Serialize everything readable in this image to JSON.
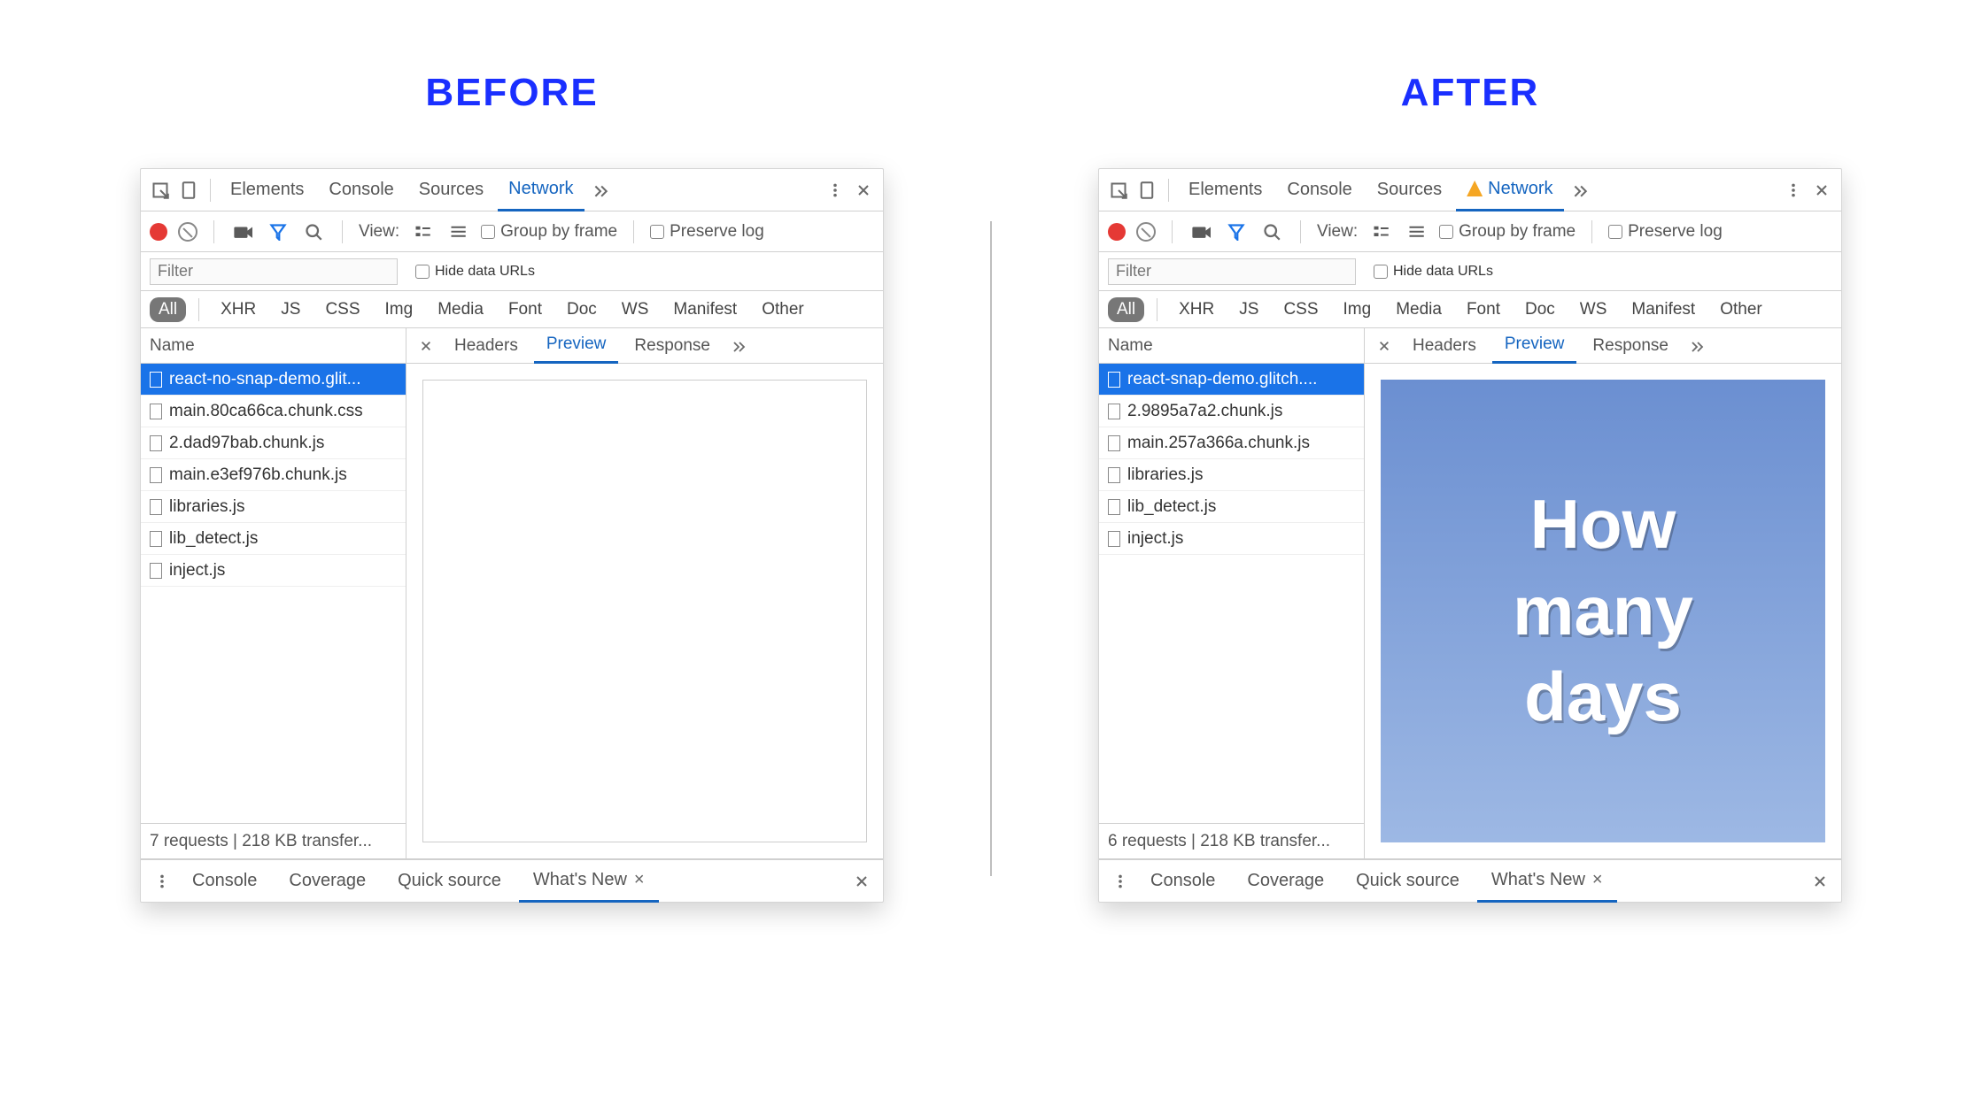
{
  "headings": {
    "before": "BEFORE",
    "after": "AFTER"
  },
  "devtools": {
    "tabs": [
      "Elements",
      "Console",
      "Sources",
      "Network"
    ],
    "toolbar": {
      "view_label": "View:",
      "group_by_frame": "Group by frame",
      "preserve_log": "Preserve log"
    },
    "filter": {
      "placeholder": "Filter",
      "hide_data_urls": "Hide data URLs"
    },
    "types": [
      "All",
      "XHR",
      "JS",
      "CSS",
      "Img",
      "Media",
      "Font",
      "Doc",
      "WS",
      "Manifest",
      "Other"
    ],
    "columns": {
      "name": "Name"
    },
    "response_tabs": [
      "Headers",
      "Preview",
      "Response"
    ],
    "drawer_tabs": [
      "Console",
      "Coverage",
      "Quick source",
      "What's New"
    ]
  },
  "before": {
    "network_has_warning": false,
    "requests": [
      "react-no-snap-demo.glit...",
      "main.80ca66ca.chunk.css",
      "2.dad97bab.chunk.js",
      "main.e3ef976b.chunk.js",
      "libraries.js",
      "lib_detect.js",
      "inject.js"
    ],
    "summary": "7 requests | 218 KB transfer...",
    "preview": {
      "mode": "blank"
    }
  },
  "after": {
    "network_has_warning": true,
    "requests": [
      "react-snap-demo.glitch....",
      "2.9895a7a2.chunk.js",
      "main.257a366a.chunk.js",
      "libraries.js",
      "lib_detect.js",
      "inject.js"
    ],
    "summary": "6 requests | 218 KB transfer...",
    "preview": {
      "mode": "rendered",
      "lines": [
        "How",
        "many",
        "days"
      ]
    }
  }
}
